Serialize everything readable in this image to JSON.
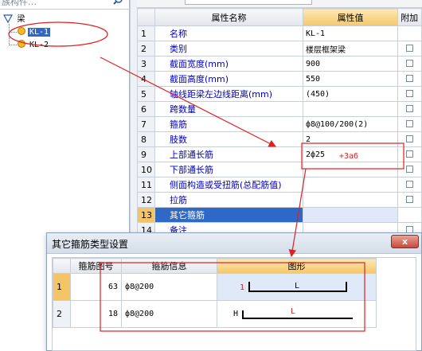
{
  "tree": {
    "search_placeholder": "族构件…",
    "root": {
      "label": "梁"
    },
    "items": [
      {
        "label": "KL-1",
        "selected": true
      },
      {
        "label": "KL-2",
        "selected": false
      }
    ]
  },
  "props": {
    "headers": {
      "num": "",
      "name": "属性名称",
      "value": "属性值",
      "extra": "附加"
    },
    "rows": [
      {
        "num": "1",
        "name": "名称",
        "value": "KL-1",
        "has_check": false
      },
      {
        "num": "2",
        "name": "类别",
        "value": "楼层框架梁",
        "has_check": true
      },
      {
        "num": "3",
        "name": "截面宽度(mm)",
        "value": "900",
        "has_check": true
      },
      {
        "num": "4",
        "name": "截面高度(mm)",
        "value": "550",
        "has_check": true
      },
      {
        "num": "5",
        "name": "轴线距梁左边线距离(mm)",
        "value": "(450)",
        "has_check": true
      },
      {
        "num": "6",
        "name": "跨数量",
        "value": "",
        "has_check": true
      },
      {
        "num": "7",
        "name": "箍筋",
        "value": "ф8@100/200(2)",
        "has_check": true
      },
      {
        "num": "8",
        "name": "肢数",
        "value": "2",
        "has_check": true
      },
      {
        "num": "9",
        "name": "上部通长筋",
        "value": "2ф25",
        "has_check": true
      },
      {
        "num": "10",
        "name": "下部通长筋",
        "value": "",
        "has_check": true
      },
      {
        "num": "11",
        "name": "侧面构造或受扭筋(总配筋值)",
        "value": "",
        "has_check": true
      },
      {
        "num": "12",
        "name": "拉筋",
        "value": "",
        "has_check": true
      },
      {
        "num": "13",
        "name": "其它箍筋",
        "value": "",
        "has_check": false,
        "selected": true
      },
      {
        "num": "14",
        "name": "备注",
        "value": "",
        "has_check": true
      }
    ],
    "annotation": "+3a6"
  },
  "dialog": {
    "title": "其它箍筋类型设置",
    "close_label": "x",
    "headers": {
      "num": "",
      "code": "箍筋图号",
      "info": "箍筋信息",
      "shape": "图形"
    },
    "rows": [
      {
        "num": "1",
        "code": "63",
        "info": "ф8@200",
        "shape_left": "1",
        "shape_mid": "L",
        "selected": true
      },
      {
        "num": "2",
        "code": "18",
        "info": "ф8@200",
        "shape_left": "H",
        "shape_mid": "L",
        "selected": false
      }
    ]
  },
  "colors": {
    "annotation_red": "#e02020",
    "selection_blue": "#2f69c8",
    "header_orange": "#f5c76b"
  }
}
